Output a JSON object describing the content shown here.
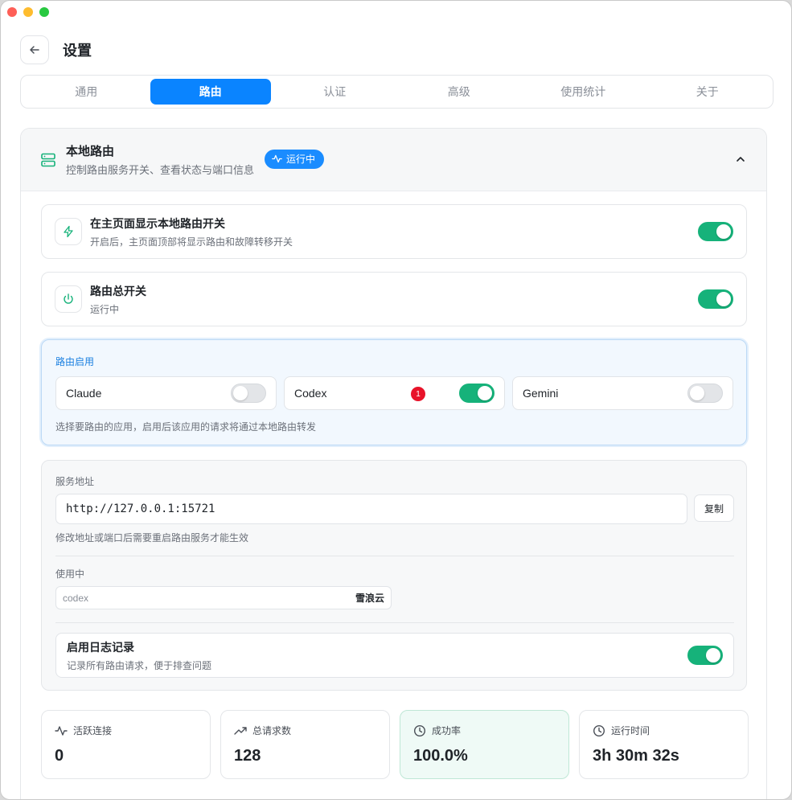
{
  "header": {
    "title": "设置"
  },
  "tabs": [
    {
      "label": "通用",
      "active": false
    },
    {
      "label": "路由",
      "active": true
    },
    {
      "label": "认证",
      "active": false
    },
    {
      "label": "高级",
      "active": false
    },
    {
      "label": "使用统计",
      "active": false
    },
    {
      "label": "关于",
      "active": false
    }
  ],
  "panel": {
    "title": "本地路由",
    "subtitle": "控制路由服务开关、查看状态与端口信息",
    "badge": "运行中",
    "icon": "server-icon"
  },
  "show_toggle": {
    "title": "在主页面显示本地路由开关",
    "desc": "开启后，主页面顶部将显示路由和故障转移开关",
    "on": true
  },
  "master": {
    "title": "路由总开关",
    "desc": "运行中",
    "on": true
  },
  "apps": {
    "label": "路由启用",
    "items": [
      {
        "name": "Claude",
        "on": false
      },
      {
        "name": "Codex",
        "on": true,
        "badge": "1"
      },
      {
        "name": "Gemini",
        "on": false
      }
    ],
    "hint": "选择要路由的应用，启用后该应用的请求将通过本地路由转发"
  },
  "service": {
    "label": "服务地址",
    "address": "http://127.0.0.1:15721",
    "copy": "复制",
    "hint": "修改地址或端口后需要重启路由服务才能生效",
    "using_label": "使用中",
    "using_key": "codex",
    "using_value": "雪浪云",
    "log_title": "启用日志记录",
    "log_desc": "记录所有路由请求，便于排查问题",
    "log_on": true
  },
  "stats": [
    {
      "label": "活跃连接",
      "value": "0",
      "icon": "activity-icon"
    },
    {
      "label": "总请求数",
      "value": "128",
      "icon": "trending-up-icon"
    },
    {
      "label": "成功率",
      "value": "100.0%",
      "icon": "clock-icon"
    },
    {
      "label": "运行时间",
      "value": "3h 30m 32s",
      "icon": "clock-icon"
    }
  ],
  "colors": {
    "accent": "#0a84ff",
    "toggle_on": "#16b27a",
    "badge": "#1a8cff"
  }
}
